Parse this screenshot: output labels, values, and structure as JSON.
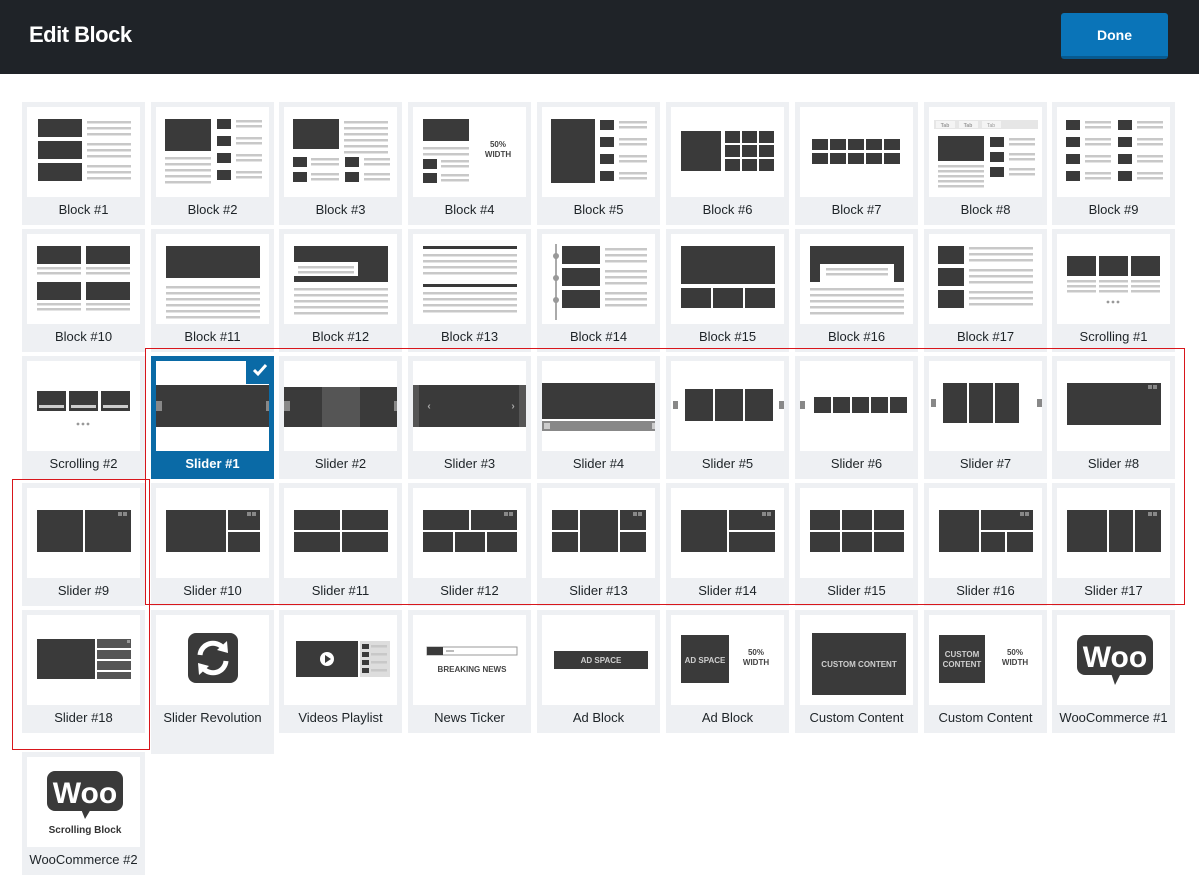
{
  "header": {
    "title": "Edit Block",
    "done_label": "Done"
  },
  "thumb_text": {
    "fifty": "50%",
    "width": "WIDTH",
    "breaking_news": "BREAKING NEWS",
    "ad_space": "AD SPACE",
    "custom_content": "CUSTOM CONTENT",
    "custom": "CUSTOM",
    "content": "CONTENT",
    "woo": "Woo",
    "scrolling_block": "Scrolling Block",
    "tab": "Tab"
  },
  "blocks": [
    {
      "label": "Block #1",
      "icon": "block-1-thumbnail-icon"
    },
    {
      "label": "Block #2",
      "icon": "block-2-thumbnail-icon"
    },
    {
      "label": "Block #3",
      "icon": "block-3-thumbnail-icon"
    },
    {
      "label": "Block #4",
      "icon": "block-4-thumbnail-icon"
    },
    {
      "label": "Block #5",
      "icon": "block-5-thumbnail-icon"
    },
    {
      "label": "Block #6",
      "icon": "block-6-thumbnail-icon"
    },
    {
      "label": "Block #7",
      "icon": "block-7-thumbnail-icon"
    },
    {
      "label": "Block #8",
      "icon": "block-8-thumbnail-icon"
    },
    {
      "label": "Block #9",
      "icon": "block-9-thumbnail-icon"
    },
    {
      "label": "Block #10",
      "icon": "block-10-thumbnail-icon"
    },
    {
      "label": "Block #11",
      "icon": "block-11-thumbnail-icon"
    },
    {
      "label": "Block #12",
      "icon": "block-12-thumbnail-icon"
    },
    {
      "label": "Block #13",
      "icon": "block-13-thumbnail-icon"
    },
    {
      "label": "Block #14",
      "icon": "block-14-thumbnail-icon"
    },
    {
      "label": "Block #15",
      "icon": "block-15-thumbnail-icon"
    },
    {
      "label": "Block #16",
      "icon": "block-16-thumbnail-icon"
    },
    {
      "label": "Block #17",
      "icon": "block-17-thumbnail-icon"
    },
    {
      "label": "Scrolling #1",
      "icon": "scrolling-1-thumbnail-icon"
    },
    {
      "label": "Scrolling #2",
      "icon": "scrolling-2-thumbnail-icon"
    },
    {
      "label": "Slider #1",
      "icon": "slider-1-thumbnail-icon",
      "selected": true
    },
    {
      "label": "Slider #2",
      "icon": "slider-2-thumbnail-icon"
    },
    {
      "label": "Slider #3",
      "icon": "slider-3-thumbnail-icon"
    },
    {
      "label": "Slider #4",
      "icon": "slider-4-thumbnail-icon"
    },
    {
      "label": "Slider #5",
      "icon": "slider-5-thumbnail-icon"
    },
    {
      "label": "Slider #6",
      "icon": "slider-6-thumbnail-icon"
    },
    {
      "label": "Slider #7",
      "icon": "slider-7-thumbnail-icon"
    },
    {
      "label": "Slider #8",
      "icon": "slider-8-thumbnail-icon"
    },
    {
      "label": "Slider #9",
      "icon": "slider-9-thumbnail-icon"
    },
    {
      "label": "Slider #10",
      "icon": "slider-10-thumbnail-icon"
    },
    {
      "label": "Slider #11",
      "icon": "slider-11-thumbnail-icon"
    },
    {
      "label": "Slider #12",
      "icon": "slider-12-thumbnail-icon"
    },
    {
      "label": "Slider #13",
      "icon": "slider-13-thumbnail-icon"
    },
    {
      "label": "Slider #14",
      "icon": "slider-14-thumbnail-icon"
    },
    {
      "label": "Slider #15",
      "icon": "slider-15-thumbnail-icon"
    },
    {
      "label": "Slider #16",
      "icon": "slider-16-thumbnail-icon"
    },
    {
      "label": "Slider #17",
      "icon": "slider-17-thumbnail-icon"
    },
    {
      "label": "Slider #18",
      "icon": "slider-18-thumbnail-icon"
    },
    {
      "label": "Slider Revolution",
      "icon": "refresh-icon"
    },
    {
      "label": "Videos Playlist",
      "icon": "video-play-icon"
    },
    {
      "label": "News Ticker",
      "icon": "news-ticker-thumbnail-icon"
    },
    {
      "label": "Ad Block",
      "icon": "ad-space-thumbnail-icon"
    },
    {
      "label": "Ad Block",
      "icon": "ad-space-half-width-thumbnail-icon"
    },
    {
      "label": "Custom Content",
      "icon": "custom-content-thumbnail-icon"
    },
    {
      "label": "Custom Content",
      "icon": "custom-content-half-width-thumbnail-icon"
    },
    {
      "label": "WooCommerce #1",
      "icon": "woocommerce-logo-icon"
    },
    {
      "label": "WooCommerce #2",
      "icon": "woocommerce-scrolling-logo-icon"
    }
  ],
  "colors": {
    "header_bg": "#1f2328",
    "done_button": "#0a74b8",
    "selected_tile": "#0a6aa6",
    "tile_bg": "#eef0f3",
    "thumb_dark": "#3a3a3a",
    "thumb_line": "#c8c8c8",
    "highlight_outline": "#d8161b"
  }
}
